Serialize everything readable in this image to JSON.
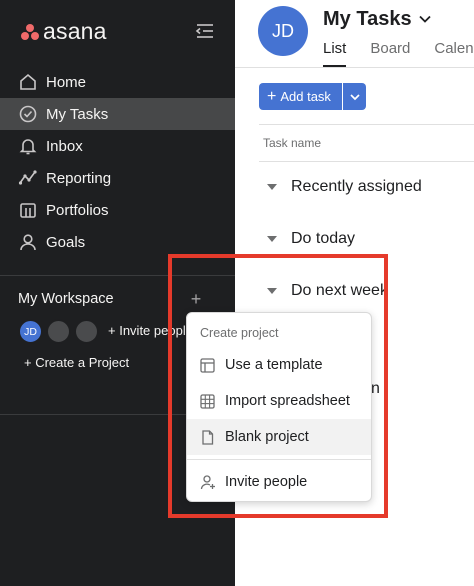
{
  "app": {
    "brand": "asana",
    "accent": "#f06a6a",
    "highlight_color": "#e53a2b"
  },
  "sidebar": {
    "items": [
      {
        "label": "Home",
        "icon": "home-icon"
      },
      {
        "label": "My Tasks",
        "icon": "check-circle-icon",
        "active": true
      },
      {
        "label": "Inbox",
        "icon": "bell-icon"
      },
      {
        "label": "Reporting",
        "icon": "line-graph-icon"
      },
      {
        "label": "Portfolios",
        "icon": "folder-icon"
      },
      {
        "label": "Goals",
        "icon": "person-icon"
      }
    ],
    "workspace": {
      "title": "My Workspace",
      "avatar_initials": "JD",
      "invite_label": "Invite people",
      "create_project_label": "Create a Project"
    }
  },
  "main": {
    "user_initials": "JD",
    "title": "My Tasks",
    "tabs": [
      {
        "label": "List",
        "active": true
      },
      {
        "label": "Board"
      },
      {
        "label": "Calendar"
      }
    ],
    "add_task_label": "Add task",
    "column_header": "Task name",
    "sections": [
      "Recently assigned",
      "Do today",
      "Do next week"
    ],
    "partial_text": "n"
  },
  "menu": {
    "header": "Create project",
    "items": [
      {
        "label": "Use a template",
        "icon": "template-icon"
      },
      {
        "label": "Import spreadsheet",
        "icon": "spreadsheet-icon"
      },
      {
        "label": "Blank project",
        "icon": "document-icon",
        "hover": true
      }
    ],
    "invite_label": "Invite people"
  }
}
